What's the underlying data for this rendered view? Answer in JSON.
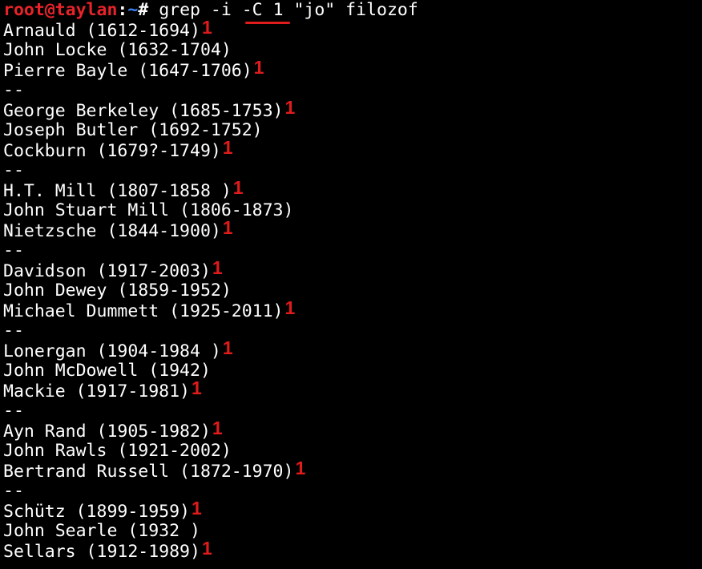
{
  "prompt": {
    "user_host": "root@taylan",
    "separator": ":",
    "path": "~",
    "symbol": "# ",
    "command": "grep -i -C 1 \"jo\" filozof"
  },
  "annotation_colors": {
    "underline": "#e01b1b",
    "marks": "#e01b1b"
  },
  "output_lines": [
    {
      "text": "Arnauld (1612-1694)",
      "mark": "1"
    },
    {
      "text": "John Locke (1632-1704)",
      "mark": ""
    },
    {
      "text": "Pierre Bayle (1647-1706)",
      "mark": "1"
    },
    {
      "text": "--",
      "mark": ""
    },
    {
      "text": "George Berkeley (1685-1753)",
      "mark": "1"
    },
    {
      "text": "Joseph Butler (1692-1752)",
      "mark": ""
    },
    {
      "text": "Cockburn (1679?-1749)",
      "mark": "1"
    },
    {
      "text": "--",
      "mark": ""
    },
    {
      "text": "H.T. Mill (1807-1858 )",
      "mark": "1"
    },
    {
      "text": "John Stuart Mill (1806-1873)",
      "mark": ""
    },
    {
      "text": "Nietzsche (1844-1900)",
      "mark": "1"
    },
    {
      "text": "--",
      "mark": ""
    },
    {
      "text": "Davidson (1917-2003)",
      "mark": "1"
    },
    {
      "text": "John Dewey (1859-1952)",
      "mark": ""
    },
    {
      "text": "Michael Dummett (1925-2011)",
      "mark": "1"
    },
    {
      "text": "--",
      "mark": ""
    },
    {
      "text": "Lonergan (1904-1984 )",
      "mark": "1"
    },
    {
      "text": "John McDowell (1942)",
      "mark": ""
    },
    {
      "text": "Mackie (1917-1981)",
      "mark": "1"
    },
    {
      "text": "--",
      "mark": ""
    },
    {
      "text": "Ayn Rand (1905-1982)",
      "mark": "1"
    },
    {
      "text": "John Rawls (1921-2002)",
      "mark": ""
    },
    {
      "text": "Bertrand Russell (1872-1970)",
      "mark": "1"
    },
    {
      "text": "--",
      "mark": ""
    },
    {
      "text": "Schütz (1899-1959)",
      "mark": "1"
    },
    {
      "text": "John Searle (1932 )",
      "mark": ""
    },
    {
      "text": "Sellars (1912-1989)",
      "mark": "1"
    }
  ]
}
